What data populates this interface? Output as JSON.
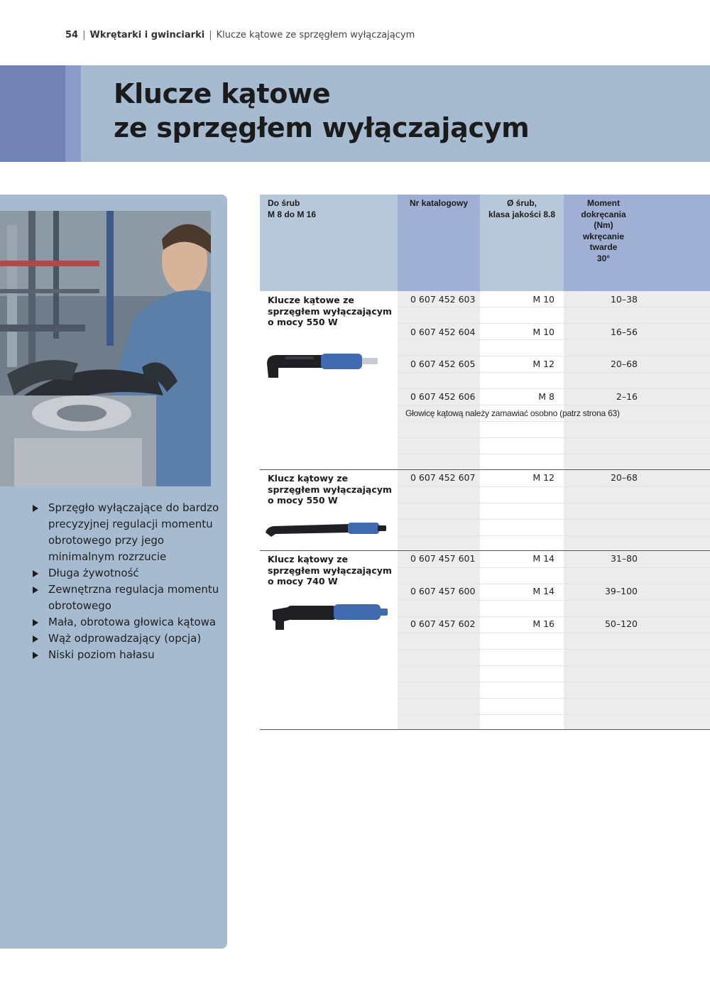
{
  "header": {
    "page_number": "54",
    "section": "Wkrętarki i gwinciarki",
    "subsection": "Klucze kątowe ze sprzęgłem wyłączającym"
  },
  "title": {
    "line1": "Klucze kątowe",
    "line2": "ze sprzęgłem wyłączającym"
  },
  "features": [
    "Sprzęgło wyłączające do bardzo precyzyjnej regulacji momentu obrotowego przy jego minimalnym rozrzucie",
    "Długa żywotność",
    "Zewnętrzna regulacja momentu obrotowego",
    "Mała, obrotowa głowica kątowa",
    "Wąż odprowadzający (opcja)",
    "Niski poziom hałasu"
  ],
  "table": {
    "headers": {
      "col1_l1": "Do śrub",
      "col1_l2": "M 8 do M 16",
      "col2": "Nr katalogowy",
      "col3_l1": "Ø śrub,",
      "col3_l2": "klasa jakości 8.8",
      "col4_l1": "Moment",
      "col4_l2": "dokręcania",
      "col4_l3": "(Nm)",
      "col4_l4": "wkręcanie",
      "col4_l5": "twarde",
      "col4_l6": "30°"
    },
    "groups": [
      {
        "name_l1": "Klucze kątowe ze",
        "name_l2": "sprzęgłem wyłączającym",
        "name_l3": "o mocy 550 W",
        "rows": [
          {
            "catalog": "0 607 452 603",
            "diameter": "M 10",
            "torque": "10–38"
          },
          {
            "catalog": "0 607 452 604",
            "diameter": "M 10",
            "torque": "16–56"
          },
          {
            "catalog": "0 607 452 605",
            "diameter": "M 12",
            "torque": "20–68"
          },
          {
            "catalog": "0 607 452 606",
            "diameter": "M 8",
            "torque": "2–16"
          }
        ],
        "note": "Głowicę kątową należy zamawiać osobno (patrz strona 63)"
      },
      {
        "name_l1": "Klucz kątowy ze",
        "name_l2": "sprzęgłem wyłączającym",
        "name_l3": "o mocy 550 W",
        "rows": [
          {
            "catalog": "0 607 452 607",
            "diameter": "M 12",
            "torque": "20–68"
          }
        ]
      },
      {
        "name_l1": "Klucz kątowy ze",
        "name_l2": "sprzęgłem wyłączającym",
        "name_l3": "o mocy 740 W",
        "rows": [
          {
            "catalog": "0 607 457 601",
            "diameter": "M 14",
            "torque": "31–80"
          },
          {
            "catalog": "0 607 457 600",
            "diameter": "M 14",
            "torque": "39–100"
          },
          {
            "catalog": "0 607 457 602",
            "diameter": "M 16",
            "torque": "50–120"
          }
        ]
      }
    ]
  },
  "colors": {
    "band": "#a6bbd0",
    "band_accent": "#7282b4",
    "header_dark": "#9fb0d4",
    "header_light": "#b7c8da"
  }
}
